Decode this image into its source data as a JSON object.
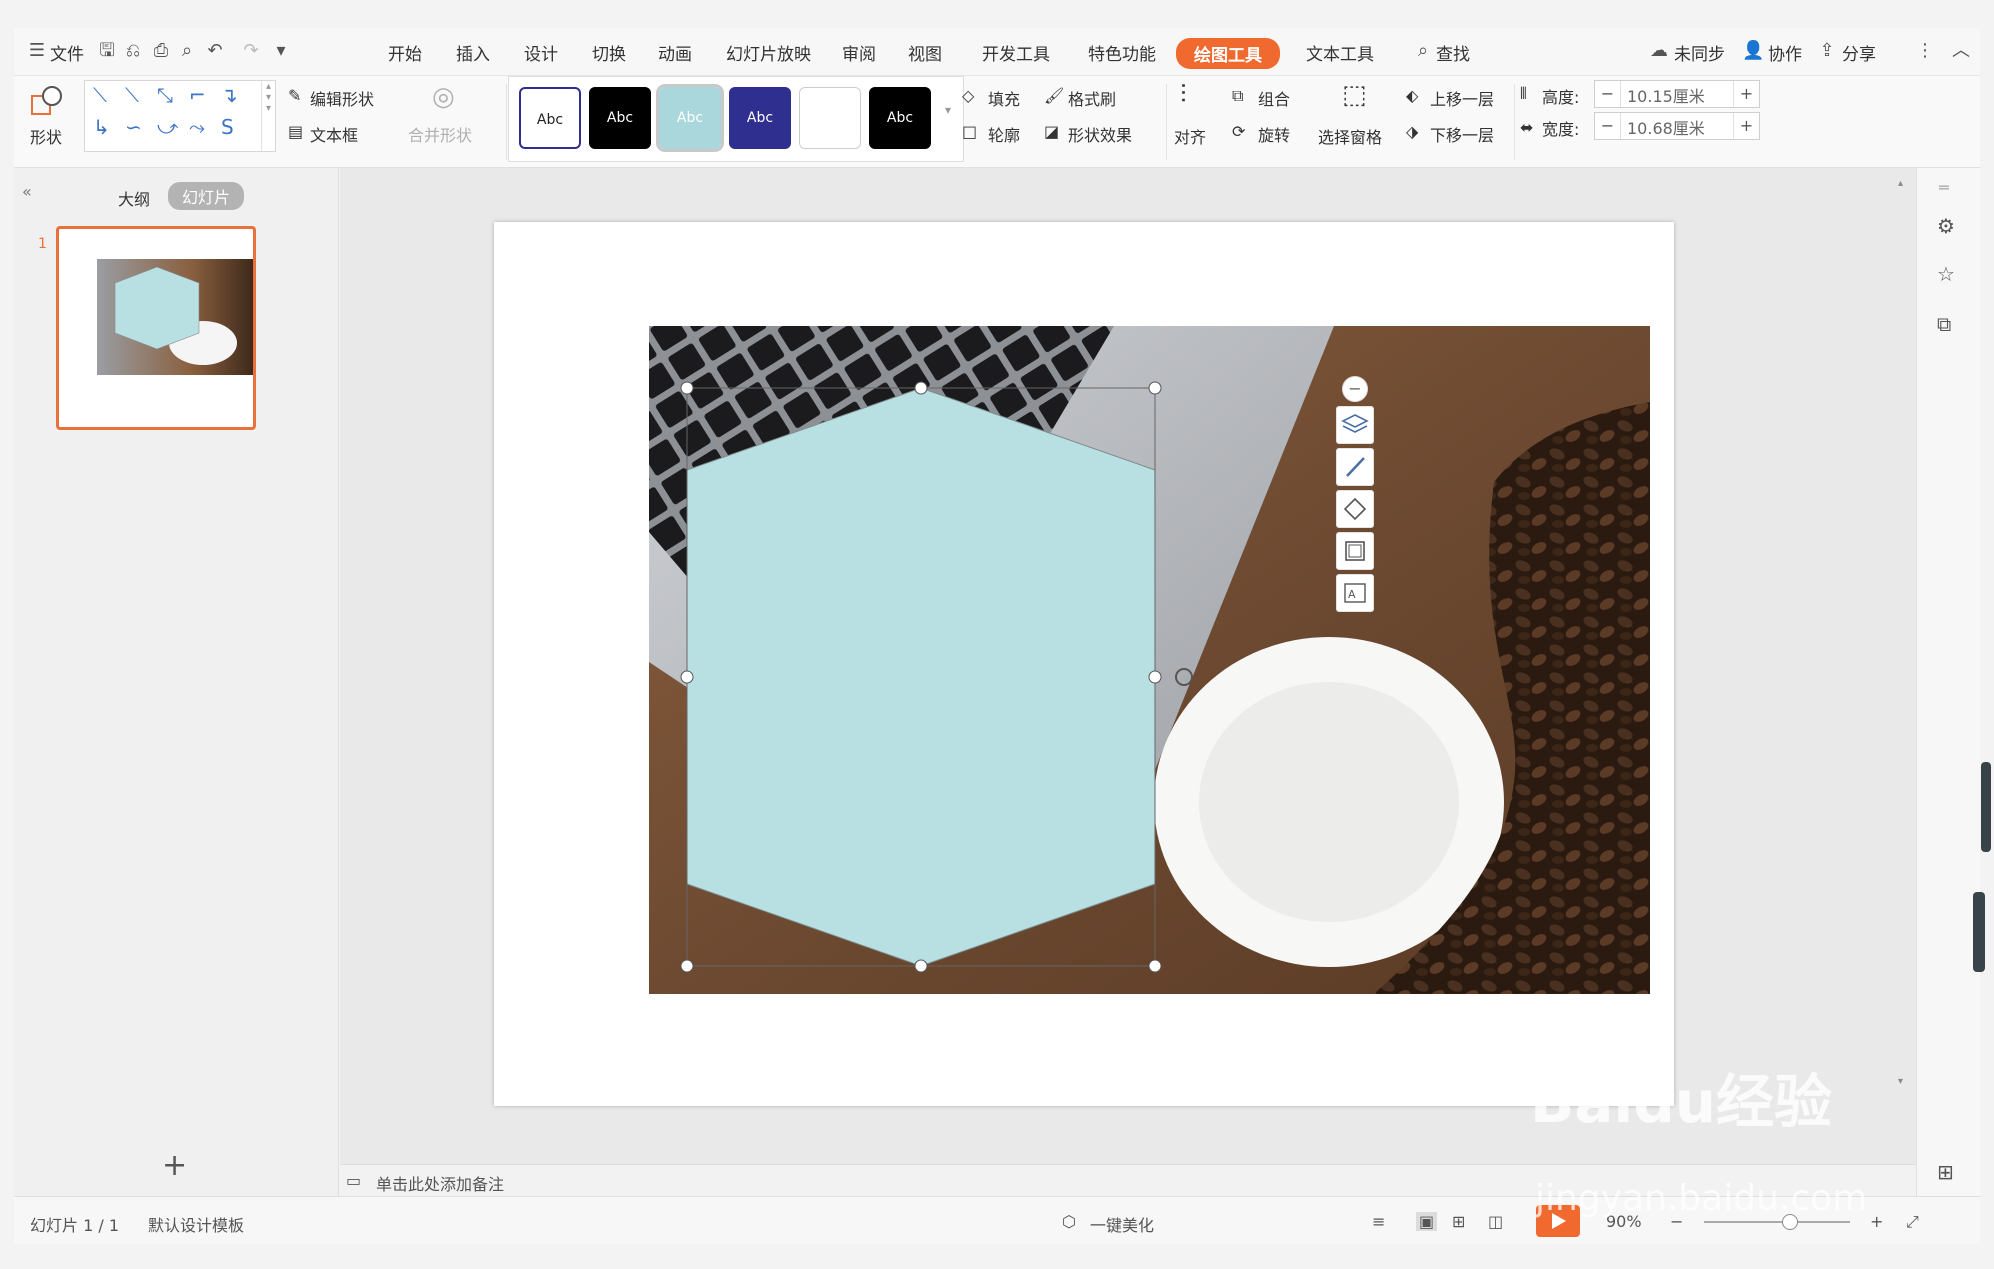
{
  "menu": {
    "file": "文件",
    "tabs": [
      "开始",
      "插入",
      "设计",
      "切换",
      "动画",
      "幻灯片放映",
      "审阅",
      "视图",
      "开发工具",
      "特色功能"
    ],
    "active_tab": "绘图工具",
    "text_tools": "文本工具",
    "search": "查找",
    "unsynced": "未同步",
    "collab": "协作",
    "share": "分享"
  },
  "ribbon": {
    "shapes": "形状",
    "edit_shape": "编辑形状",
    "textbox": "文本框",
    "merge_shape": "合并形状",
    "styles": [
      "Abc",
      "Abc",
      "Abc",
      "Abc",
      "",
      "Abc"
    ],
    "fill": "填充",
    "format_painter": "格式刷",
    "outline": "轮廓",
    "shape_effect": "形状效果",
    "align": "对齐",
    "group": "组合",
    "rotate": "旋转",
    "selection_pane": "选择窗格",
    "bring_forward": "上移一层",
    "send_backward": "下移一层",
    "height_label": "高度:",
    "height_value": "10.15厘米",
    "width_label": "宽度:",
    "width_value": "10.68厘米"
  },
  "leftpane": {
    "outline_tab": "大纲",
    "slides_tab": "幻灯片",
    "slide_number": "1"
  },
  "notes": {
    "placeholder": "单击此处添加备注"
  },
  "status": {
    "slide_info": "幻灯片 1 / 1",
    "template": "默认设计模板",
    "beautify": "一键美化",
    "zoom": "90%"
  },
  "colors": {
    "accent": "#f06a2f",
    "hexagon_fill": "#b8dfe2",
    "style_navy": "#2f2f8f",
    "style_light_blue": "#a9d7dc"
  },
  "watermark": {
    "brand": "Baidu经验",
    "url": "jingyan.baidu.com"
  }
}
